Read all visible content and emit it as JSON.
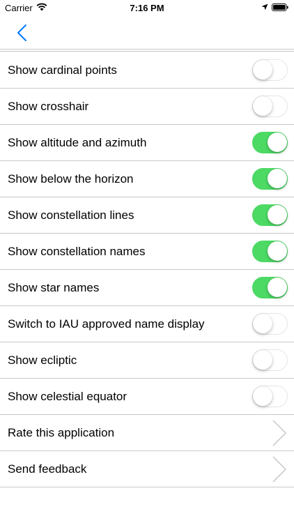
{
  "status_bar": {
    "carrier": "Carrier",
    "time": "7:16 PM"
  },
  "nav": {
    "back_icon": "chevron-left-icon"
  },
  "colors": {
    "accent": "#007aff",
    "toggle_on": "#4cd964",
    "separator": "#c8c8cc"
  },
  "settings": [
    {
      "label": "Show cardinal points",
      "type": "toggle",
      "on": false
    },
    {
      "label": "Show crosshair",
      "type": "toggle",
      "on": false
    },
    {
      "label": "Show altitude and azimuth",
      "type": "toggle",
      "on": true
    },
    {
      "label": "Show below the horizon",
      "type": "toggle",
      "on": true
    },
    {
      "label": "Show constellation lines",
      "type": "toggle",
      "on": true
    },
    {
      "label": "Show constellation names",
      "type": "toggle",
      "on": true
    },
    {
      "label": "Show star names",
      "type": "toggle",
      "on": true
    },
    {
      "label": "Switch to IAU approved name display",
      "type": "toggle",
      "on": false
    },
    {
      "label": "Show ecliptic",
      "type": "toggle",
      "on": false
    },
    {
      "label": "Show celestial equator",
      "type": "toggle",
      "on": false
    },
    {
      "label": "Rate this application",
      "type": "link"
    },
    {
      "label": "Send feedback",
      "type": "link"
    }
  ]
}
